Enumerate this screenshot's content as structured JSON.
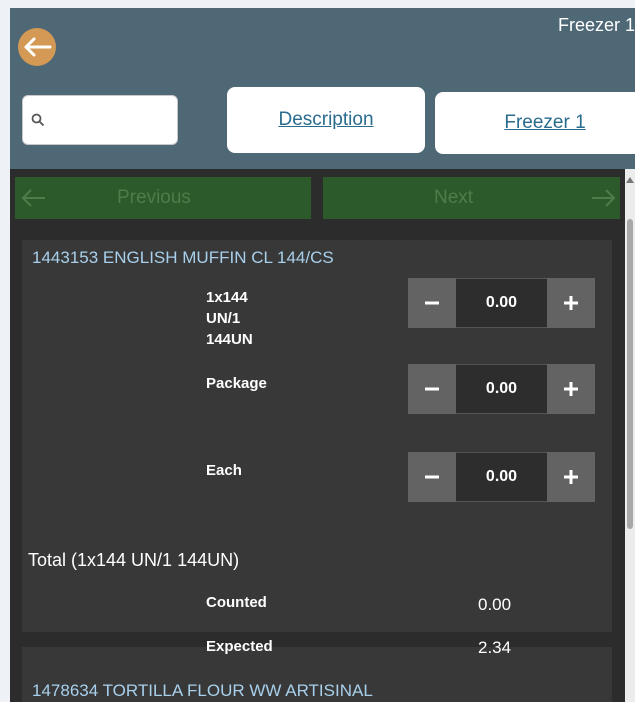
{
  "window": {
    "title": "Freezer 1"
  },
  "search": {
    "placeholder": ""
  },
  "tabs": {
    "description": "Description",
    "location": "Freezer 1"
  },
  "nav": {
    "previous": "Previous",
    "next": "Next"
  },
  "items": [
    {
      "title": "1443153 ENGLISH MUFFIN CL 144/CS",
      "unit_lines": [
        "1x144",
        "UN/1",
        "144UN"
      ],
      "rows": [
        {
          "label": "",
          "value": "0.00"
        },
        {
          "label": "Package",
          "value": "0.00"
        },
        {
          "label": "Each",
          "value": "0.00"
        }
      ],
      "total_label": "Total (1x144 UN/1 144UN)",
      "counted_label": "Counted",
      "counted_value": "0.00",
      "expected_label": "Expected",
      "expected_value": "2.34"
    },
    {
      "title": "1478634 TORTILLA FLOUR WW ARTISINAL"
    }
  ],
  "colors": {
    "header": "#4e6876",
    "nav_button": "#2d5a2b",
    "back_button": "#d49a55",
    "item_title": "#a8d0ec"
  },
  "icons": {
    "back": "arrow-left-icon",
    "search": "search-icon",
    "minus": "minus-icon",
    "plus": "plus-icon"
  }
}
